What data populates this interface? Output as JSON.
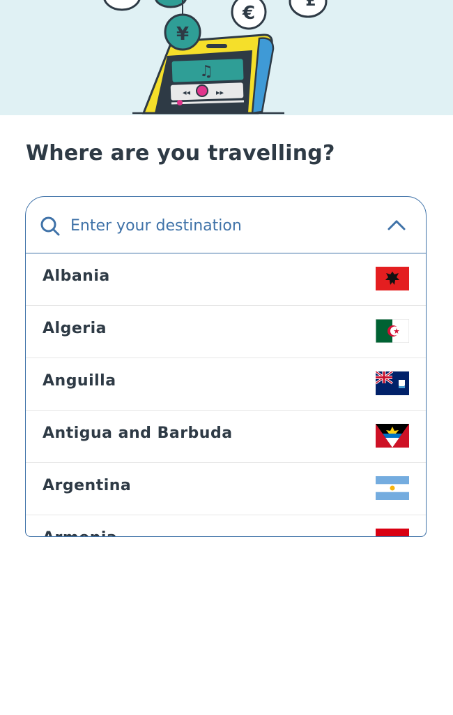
{
  "hero": {
    "illustration": "phone-with-currency-coins",
    "coin_symbols": [
      "¥",
      "€",
      "£"
    ],
    "colors": {
      "background": "#e0f1f4",
      "phone": "#f5df2a",
      "screen": "#2f9e96",
      "accent": "#e0358c"
    }
  },
  "title": "Where are you travelling?",
  "search": {
    "placeholder": "Enter your destination",
    "value": ""
  },
  "icons": {
    "search": "search-icon",
    "toggle": "chevron-up-icon"
  },
  "countries": [
    {
      "name": "Albania",
      "flag": "flag-albania-icon"
    },
    {
      "name": "Algeria",
      "flag": "flag-algeria-icon"
    },
    {
      "name": "Anguilla",
      "flag": "flag-anguilla-icon"
    },
    {
      "name": "Antigua and Barbuda",
      "flag": "flag-antigua-and-barbuda-icon"
    },
    {
      "name": "Argentina",
      "flag": "flag-argentina-icon"
    },
    {
      "name": "Armenia",
      "flag": "flag-armenia-icon"
    }
  ],
  "colors": {
    "accent": "#3f72a8",
    "text": "#2e3a45",
    "divider": "#e6e6e6"
  }
}
